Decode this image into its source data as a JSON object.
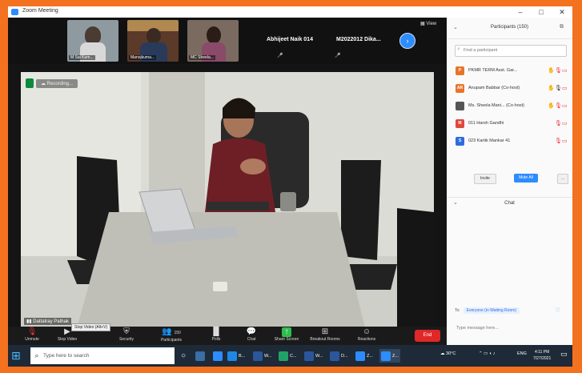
{
  "window": {
    "title": "Zoom Meeting"
  },
  "video_strip": {
    "thumbnails": [
      {
        "name": "M Sai Kum..."
      },
      {
        "name": "Manojkuma..."
      },
      {
        "name": "MC Sheela..."
      }
    ],
    "name_tiles": [
      {
        "name": "Abhijeet Naik 014"
      },
      {
        "name": "M2022012 Dika..."
      }
    ],
    "view_label": "View"
  },
  "main_video": {
    "recording_label": "Recording...",
    "speaker_name": "Dattatray Pathak"
  },
  "toolbar": {
    "items": [
      {
        "label": "Unmute",
        "icon": "mic-muted-icon"
      },
      {
        "label": "Stop Video",
        "icon": "video-icon"
      },
      {
        "label": "Security",
        "icon": "shield-icon"
      },
      {
        "label": "Participants",
        "count": "150",
        "icon": "participants-icon"
      },
      {
        "label": "Polls",
        "icon": "polls-icon"
      },
      {
        "label": "Chat",
        "icon": "chat-icon"
      },
      {
        "label": "Share Screen",
        "icon": "share-screen-icon"
      },
      {
        "label": "Breakout Rooms",
        "icon": "breakout-icon"
      },
      {
        "label": "Reactions",
        "icon": "reactions-icon"
      }
    ],
    "tooltip": "Stop Video (Alt+V)",
    "end_label": "End"
  },
  "participants_panel": {
    "title": "Participants (150)",
    "search_placeholder": "Find a participant",
    "participants": [
      {
        "initials": "P",
        "name": "PKMR TERM Asst. Gar...",
        "color": "#e8742a"
      },
      {
        "initials": "AR",
        "name": "Anupam Babbar (Co-host)",
        "color": "#e8742a"
      },
      {
        "initials": "",
        "name": "Ms. Sheela Mani... (Co-host)",
        "color": "#555555"
      },
      {
        "initials": "M",
        "name": "011 Harsh Gandhi",
        "color": "#e0483a"
      },
      {
        "initials": "S",
        "name": "023 Kartik Mankar 41",
        "color": "#2d6cdf"
      }
    ],
    "invite_label": "Invite",
    "mute_all_label": "Mute All",
    "more_label": "...",
    "chat_title": "Chat",
    "to_label": "To:",
    "to_value": "Everyone (in Waiting Room)",
    "message_placeholder": "Type message here..."
  },
  "taskbar": {
    "search_placeholder": "Type here to search",
    "apps": [
      {
        "label": "",
        "color": "#2d8cff"
      },
      {
        "label": "B...",
        "color": "#1e88e5"
      },
      {
        "label": "W...",
        "color": "#2b579a"
      },
      {
        "label": "C...",
        "color": "#21a366"
      },
      {
        "label": "W...",
        "color": "#2b579a"
      },
      {
        "label": "D...",
        "color": "#2b579a"
      },
      {
        "label": "Z...",
        "color": "#2d8cff"
      },
      {
        "label": "Z...",
        "color": "#2d8cff"
      }
    ],
    "weather": "30°C",
    "time": "4:11 PM",
    "date": "7/27/2021",
    "lang": "ENG"
  }
}
